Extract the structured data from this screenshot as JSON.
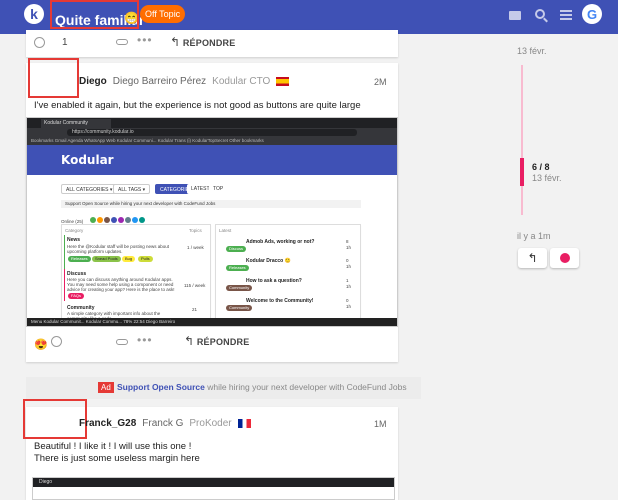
{
  "header": {
    "logo_letter": "k",
    "topic_title": "Quite familiar",
    "topic_emoji": "😁",
    "category": "Off Topic",
    "avatar_letter": "G",
    "colors": {
      "bar": "#3f51b5",
      "category": "#ff6d00"
    }
  },
  "top_actions": {
    "count": "1",
    "reply": "RÉPONDRE"
  },
  "post1": {
    "username": "Diego",
    "fullname": "Diego Barreiro Pérez",
    "user_title": "Kodular CTO",
    "flag": "es-flag-icon",
    "date": "2M",
    "text": "I've enabled it again, but the experience is not good as buttons are quite large",
    "reaction": "😍",
    "reply": "RÉPONDRE"
  },
  "screenshot": {
    "tab": "Kodular Community",
    "url": "https://community.kodular.io",
    "bookmarks": "Bookmarks  Gmail  Agenda  WhatsApp Web  Kodular Communi...  Kodular  Trans (i)  KodularTopSecret          Other bookmarks",
    "logo": "Kodular",
    "nav": [
      "ALL CATEGORIES ▾",
      "ALL TAGS ▾",
      "CATEGORIES",
      "LATEST",
      "TOP"
    ],
    "ad_line": "Support Open Source while hiring your next developer with CodeFund Jobs",
    "online_label": "Online (25)",
    "col_category": "Category",
    "col_topics": "Topics",
    "col_latest": "Latest",
    "categories": [
      {
        "name": "News",
        "desc": "Here the @Kodular staff will be posting news about upcoming platform updates.",
        "count": "1 / week"
      },
      {
        "name": "Discuss",
        "desc": "Here you can discuss anything around Kodular apps. You may need some help using a component or need advice for creating your app? Here is the place to ask!",
        "count": "115 / week"
      },
      {
        "name": "Community",
        "desc": "A simple category with important info about the community like a code...",
        "count": "21"
      }
    ],
    "pills": [
      "Releases",
      "Snead Pools",
      "Bug",
      "Pulls",
      "FAQs"
    ],
    "latest": [
      {
        "title": "Admob Ads, working or not?",
        "tag": "Discuss",
        "n": "8",
        "m": "1h"
      },
      {
        "title": "Kodular Dracco 🙂",
        "tag": "Releases",
        "n": "0",
        "m": "1h"
      },
      {
        "title": "How to ask a question?",
        "tag": "Community",
        "n": "1",
        "m": "1h"
      },
      {
        "title": "Welcome to the Community!",
        "tag": "Community",
        "n": "0",
        "m": "1h"
      }
    ],
    "taskbar": "Menu     Kodular Communit...     Kodular Commu...                                      78%   22:54   Diego Barreiro"
  },
  "timeline": {
    "date_top": "13 févr.",
    "position": "6 / 8",
    "date_mid": "13 févr.",
    "ago": "il y a 1m",
    "progress": 0.75
  },
  "ad": {
    "badge": "Ad",
    "strong": "Support Open Source",
    "rest": " while hiring your next developer with CodeFund Jobs"
  },
  "post2": {
    "username": "Franck_G28",
    "fullname": "Franck G",
    "user_title": "ProKoder",
    "flag": "fr-flag-icon",
    "date": "1M",
    "line1": "Beautiful ! I like it ! I will use this one !",
    "line2": "There is just some useless margin here",
    "shot_tab": "Diego"
  }
}
